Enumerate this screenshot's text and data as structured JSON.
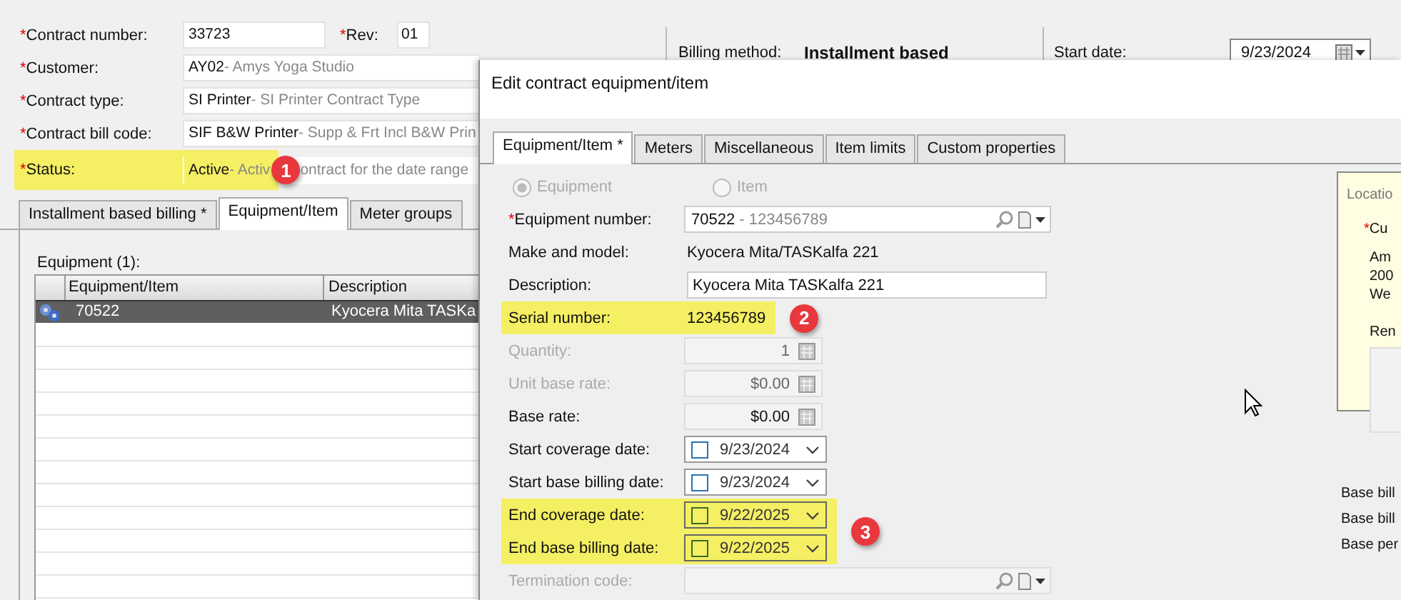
{
  "main_form": {
    "rows": [
      {
        "label": "Contract number:",
        "asterisk": "*",
        "value": "33723",
        "rev": {
          "label": "Rev:",
          "asterisk": "*",
          "value": "01"
        },
        "highlighted": false
      },
      {
        "label": "Customer:",
        "asterisk": "*",
        "value": "AY02",
        "description": "- Amys Yoga Studio",
        "highlighted": false
      },
      {
        "label": "Contract type:",
        "asterisk": "*",
        "value": "SI Printer",
        "description": "- SI Printer Contract Type",
        "highlighted": false
      },
      {
        "label": "Contract bill code:",
        "asterisk": "*",
        "value": "SIF B&W Printer",
        "description": "- Supp & Frt Incl B&W Prin",
        "highlighted": false
      },
      {
        "label": "Status:",
        "asterisk": "*",
        "value": "Active",
        "description": "- Activ",
        "marker": "1",
        "after_marker": "ontract for the date range",
        "highlighted": true
      }
    ]
  },
  "billing_method": {
    "label": "Billing method:",
    "value": "Installment based"
  },
  "start_date": {
    "label": "Start date:",
    "value": "9/23/2024"
  },
  "tabs": [
    {
      "label": "Installment based billing *",
      "selected": false
    },
    {
      "label": "Equipment/Item",
      "selected": true
    },
    {
      "label": "Meter groups",
      "selected": false
    }
  ],
  "equipment": {
    "title": "Equipment (1):",
    "columns": [
      "Equipment/Item",
      "Description"
    ],
    "rows": [
      {
        "cells": [
          "70522",
          "Kyocera Mita TASKa"
        ],
        "selected": true
      }
    ]
  },
  "dialog": {
    "title": "Edit contract equipment/item",
    "tabs": [
      {
        "label": "Equipment/Item *",
        "selected": true
      },
      {
        "label": "Meters",
        "selected": false
      },
      {
        "label": "Miscellaneous",
        "selected": false
      },
      {
        "label": "Item limits",
        "selected": false
      },
      {
        "label": "Custom properties",
        "selected": false
      }
    ],
    "radios": [
      {
        "label": "Equipment",
        "selected": true,
        "disabled": true
      },
      {
        "label": "Item",
        "selected": false,
        "disabled": true
      }
    ],
    "field_groups": [
      {
        "highlighted": false,
        "fields": [
          {
            "kind": "lookup",
            "label": "Equipment number:",
            "asterisk": "*",
            "disabled": false,
            "value": "70522",
            "description": "- 123456789"
          },
          {
            "kind": "text",
            "label": "Make and model:",
            "disabled": false,
            "value": "Kyocera Mita/TASKalfa 221"
          },
          {
            "kind": "input",
            "label": "Description:",
            "disabled": false,
            "value": "Kyocera Mita TASKalfa 221"
          }
        ]
      },
      {
        "highlighted": true,
        "marker": "2",
        "fields": [
          {
            "kind": "text",
            "label": "Serial number:",
            "disabled": false,
            "value": "123456789"
          }
        ]
      },
      {
        "highlighted": false,
        "fields": [
          {
            "kind": "number",
            "label": "Quantity:",
            "disabled": true,
            "value": "1"
          },
          {
            "kind": "number",
            "label": "Unit base rate:",
            "disabled": true,
            "value": "$0.00"
          },
          {
            "kind": "number",
            "label": "Base rate:",
            "disabled": false,
            "value": "$0.00"
          },
          {
            "kind": "date",
            "label": "Start coverage date:",
            "disabled": false,
            "checked": false,
            "value": "9/23/2024"
          },
          {
            "kind": "date",
            "label": "Start base billing date:",
            "disabled": false,
            "checked": false,
            "value": "9/23/2024"
          }
        ]
      },
      {
        "highlighted": true,
        "marker": "3",
        "fields": [
          {
            "kind": "date",
            "label": "End coverage date:",
            "disabled": false,
            "checked": false,
            "value": "9/22/2025"
          },
          {
            "kind": "date",
            "label": "End base billing date:",
            "disabled": false,
            "checked": false,
            "value": "9/22/2025"
          }
        ]
      },
      {
        "highlighted": false,
        "fields": [
          {
            "kind": "lookup",
            "label": "Termination code:",
            "disabled": true
          }
        ]
      }
    ],
    "location": {
      "title": "Locatio",
      "label": "Cu",
      "asterisk": "*",
      "lines": [
        "Am",
        "200",
        "We"
      ],
      "remarks_label": "Ren"
    },
    "base_rows": [
      "Base bill",
      "Base bill",
      "Base per"
    ]
  }
}
